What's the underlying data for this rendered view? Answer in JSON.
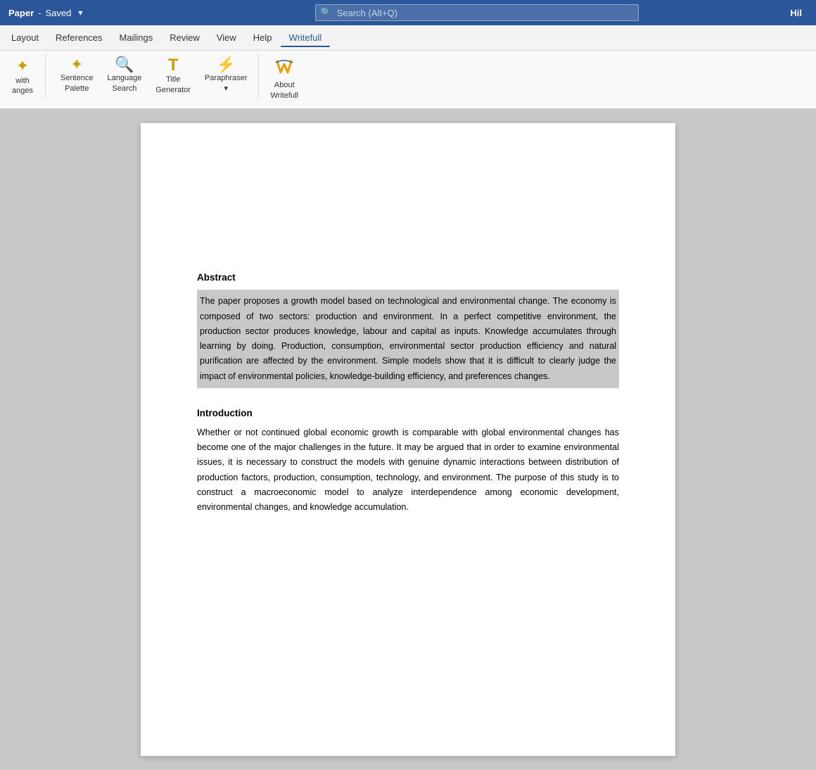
{
  "titlebar": {
    "doc_name": "Paper",
    "separator": "-",
    "saved_label": "Saved",
    "dropdown_icon": "▾",
    "search_placeholder": "Search (Alt+Q)",
    "user_initial": "Hil"
  },
  "menubar": {
    "items": [
      {
        "id": "layout",
        "label": "Layout"
      },
      {
        "id": "references",
        "label": "References"
      },
      {
        "id": "mailings",
        "label": "Mailings"
      },
      {
        "id": "review",
        "label": "Review"
      },
      {
        "id": "view",
        "label": "View"
      },
      {
        "id": "help",
        "label": "Help"
      },
      {
        "id": "writefull",
        "label": "Writefull",
        "active": true
      }
    ]
  },
  "ribbon": {
    "left_group": {
      "icon": "✦",
      "line1": "with",
      "line2": "anges"
    },
    "buttons": [
      {
        "id": "sentence-palette",
        "icon": "✦",
        "icon_color": "#c8a000",
        "label_line1": "Sentence",
        "label_line2": "Palette"
      },
      {
        "id": "language-search",
        "icon": "🔍",
        "icon_color": "#c8a000",
        "label_line1": "Language",
        "label_line2": "Search"
      },
      {
        "id": "title-generator",
        "icon": "T",
        "icon_color": "#c8a000",
        "label_line1": "Title",
        "label_line2": "Generator"
      },
      {
        "id": "paraphraser",
        "icon": "⚡",
        "icon_color": "#c8a000",
        "label_line1": "Paraphraser",
        "label_line2": "▾"
      },
      {
        "id": "about-writefull",
        "icon": "W",
        "icon_color": "#e8a000",
        "label_line1": "About",
        "label_line2": "Writefull"
      }
    ]
  },
  "document": {
    "abstract_heading": "Abstract",
    "abstract_text": "The paper proposes a growth model based on technological and environmental change. The economy is composed of two sectors: production and environment. In a perfect competitive environment, the production sector produces knowledge, labour and capital as inputs. Knowledge accumulates through learning by doing. Production, consumption, environmental sector production efficiency and natural purification are affected by the environment. Simple models show that it is difficult to clearly judge the impact of environmental policies, knowledge-building efficiency, and preferences changes.",
    "intro_heading": "Introduction",
    "intro_text": "Whether or not continued global economic growth is comparable with global environmental changes has become one of the major challenges in the future. It may be argued that in order to examine environmental issues, it is necessary to construct the models with genuine dynamic interactions between distribution of production factors, production, consumption, technology, and environment. The purpose of this study is to construct a macroeconomic model to analyze interdependence among economic development, environmental changes, and knowledge accumulation."
  }
}
